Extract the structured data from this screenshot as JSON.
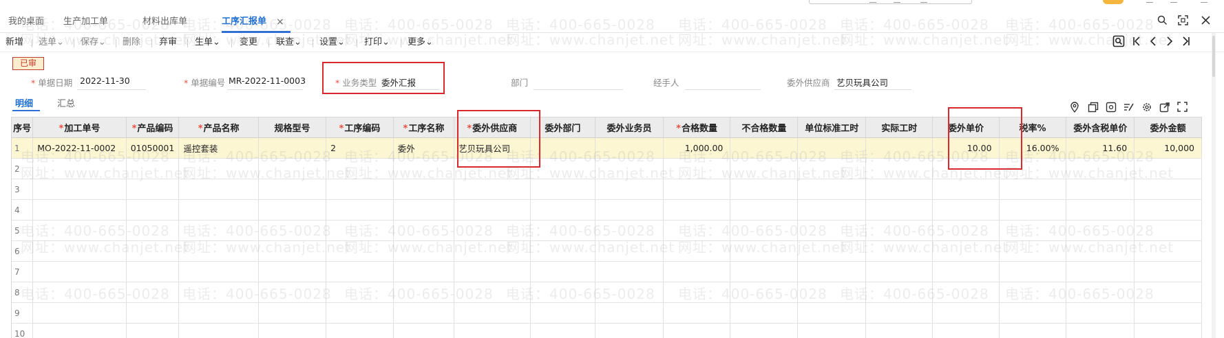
{
  "tabs": [
    {
      "label": "我的桌面",
      "active": false
    },
    {
      "label": "生产加工单",
      "active": false
    },
    {
      "label": "材料出库单",
      "active": false
    },
    {
      "label": "工序汇报单",
      "active": true
    }
  ],
  "tab_close_glyph": "×",
  "window_controls": [
    "search-icon",
    "restore-icon",
    "close-icon"
  ],
  "toolbar": {
    "new": "新增",
    "select_doc": "选单",
    "save": "保存",
    "delete": "删除",
    "abandon": "弃审",
    "generate": "生单",
    "change": "变更",
    "query": "联查",
    "settings": "设置",
    "print": "打印",
    "more": "更多"
  },
  "status_badge": "已审",
  "form": {
    "doc_date_label": "单据日期",
    "doc_date_value": "2022-11-30",
    "doc_no_label": "单据编号",
    "doc_no_value": "MR-2022-11-0003",
    "biz_type_label": "业务类型",
    "biz_type_value": "委外汇报",
    "dept_label": "部门",
    "handler_label": "经手人",
    "supplier_label": "委外供应商",
    "supplier_value": "艺贝玩具公司"
  },
  "subtabs": [
    {
      "label": "明细",
      "active": true
    },
    {
      "label": "汇总",
      "active": false
    }
  ],
  "grid": {
    "columns": [
      {
        "label": "序号",
        "required": false
      },
      {
        "label": "加工单号",
        "required": true
      },
      {
        "label": "产品编码",
        "required": true
      },
      {
        "label": "产品名称",
        "required": true
      },
      {
        "label": "规格型号",
        "required": false
      },
      {
        "label": "工序编码",
        "required": true
      },
      {
        "label": "工序名称",
        "required": true
      },
      {
        "label": "委外供应商",
        "required": true
      },
      {
        "label": "委外部门",
        "required": false
      },
      {
        "label": "委外业务员",
        "required": false
      },
      {
        "label": "合格数量",
        "required": true
      },
      {
        "label": "不合格数量",
        "required": false
      },
      {
        "label": "单位标准工时",
        "required": false
      },
      {
        "label": "实际工时",
        "required": false
      },
      {
        "label": "委外单价",
        "required": false
      },
      {
        "label": "税率%",
        "required": false
      },
      {
        "label": "委外含税单价",
        "required": false
      },
      {
        "label": "委外金额",
        "required": false
      }
    ],
    "rows": [
      [
        "1",
        "MO-2022-11-0002",
        "01050001",
        "遥控套装",
        "",
        "2",
        "委外",
        "艺贝玩具公司",
        "",
        "",
        "1,000.00",
        "",
        "",
        "",
        "10.00",
        "16.00%",
        "11.60",
        "10,000"
      ],
      [
        "2"
      ],
      [
        "3"
      ],
      [
        "4"
      ],
      [
        "5"
      ],
      [
        "6"
      ],
      [
        "7"
      ],
      [
        "8"
      ],
      [
        "9"
      ],
      [
        "10"
      ]
    ]
  },
  "watermarks": {
    "phone": "电话：400-665-0028",
    "site": "网址：www.chanjet.net"
  }
}
